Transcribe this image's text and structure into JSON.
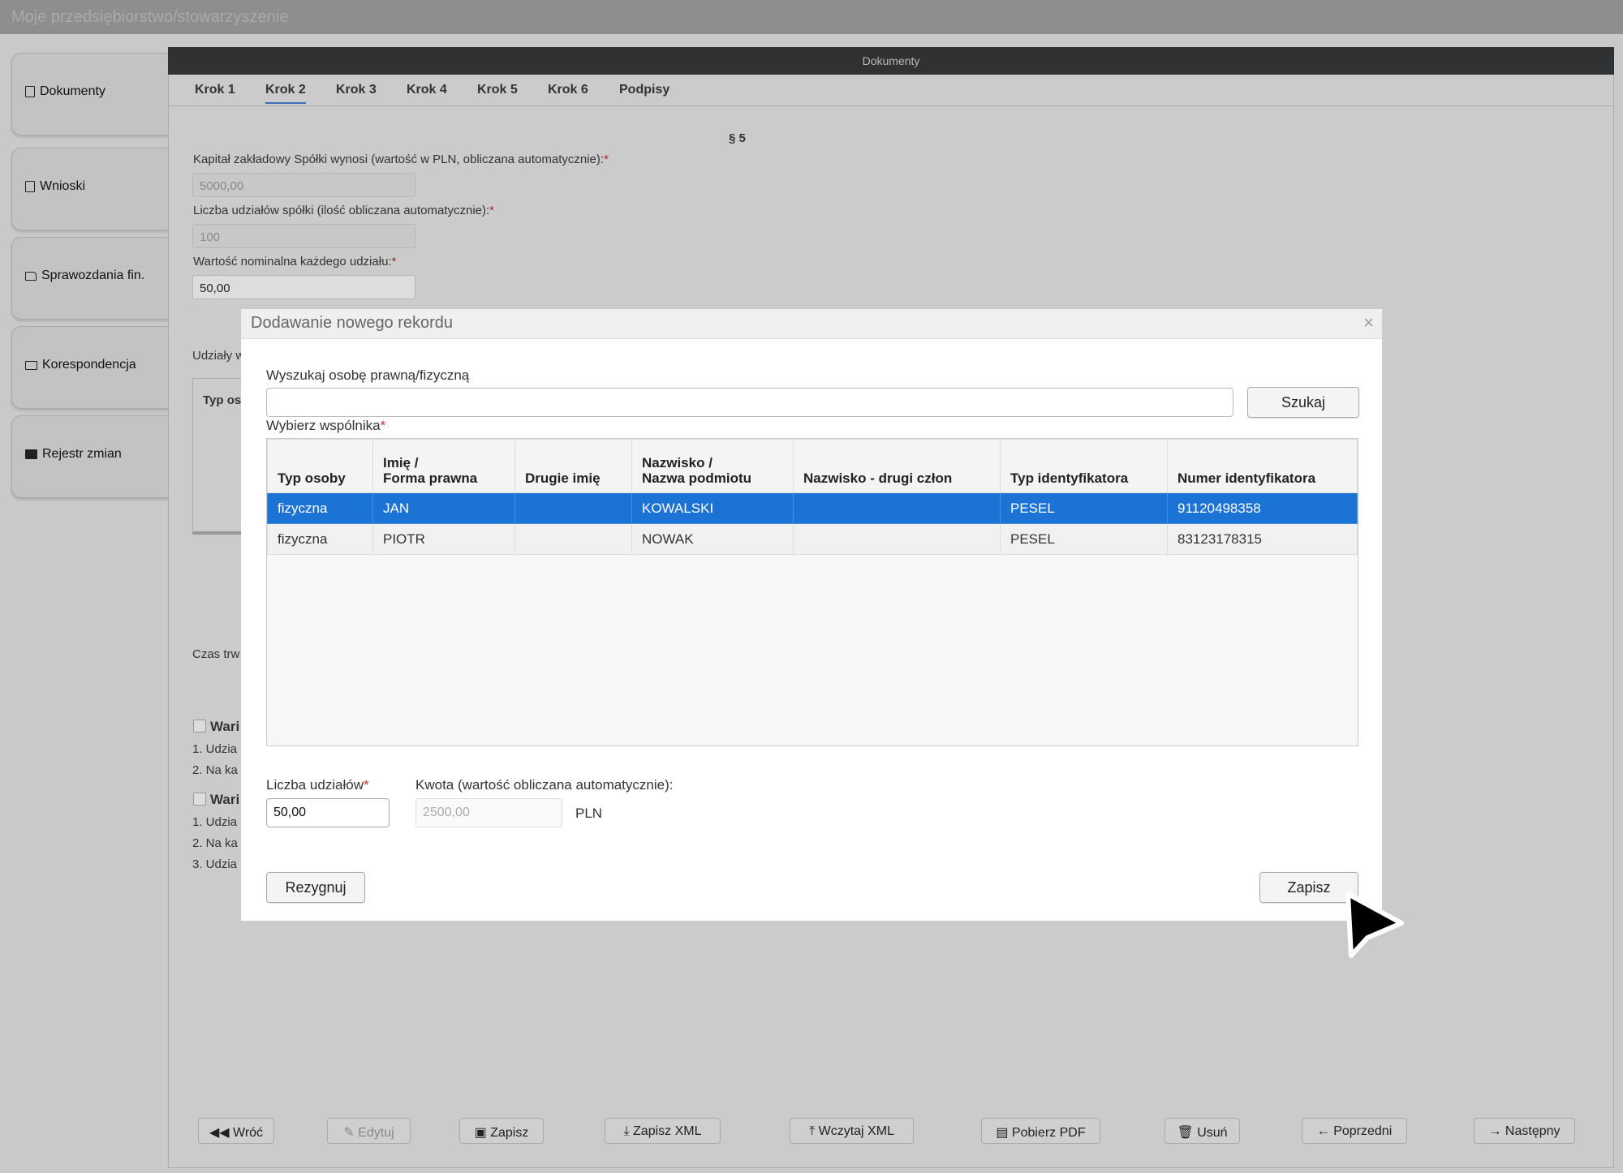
{
  "window": {
    "title": "Moje przedsiębiorstwo/stowarzyszenie"
  },
  "sidebar": {
    "items": [
      {
        "label": "Dokumenty",
        "icon": "document-icon"
      },
      {
        "label": "Wnioski",
        "icon": "document-icon"
      },
      {
        "label": "Sprawozdania fin.",
        "icon": "folder-open-icon"
      },
      {
        "label": "Korespondencja",
        "icon": "envelope-icon"
      },
      {
        "label": "Rejestr zmian",
        "icon": "briefcase-icon"
      }
    ]
  },
  "panel": {
    "title": "Dokumenty",
    "tabs": [
      "Krok 1",
      "Krok 2",
      "Krok 3",
      "Krok 4",
      "Krok 5",
      "Krok 6",
      "Podpisy"
    ],
    "active_tab": "Krok 2",
    "section": "§ 5",
    "capital_label": "Kapitał zakładowy Spółki wynosi (wartość w PLN, obliczana automatycznie):",
    "capital_value": "5000,00",
    "shares_count_label": "Liczba udziałów spółki (ilość obliczana automatycznie):",
    "shares_count_value": "100",
    "nominal_label": "Wartość nominalna każdego udziału:",
    "nominal_value": "50,00",
    "partial_shares_label": "Udziały w",
    "partial_typ": "Typ os",
    "partial_czas": "Czas trw",
    "partial_wari_1": "Wari",
    "partial_wari_2": "Wari",
    "partial_lines_1": [
      "1. Udzia",
      "2. Na ka"
    ],
    "partial_lines_2": [
      "1. Udzia",
      "2. Na ka",
      "3. Udzia"
    ]
  },
  "footer_buttons": [
    "Wróć",
    "Edytuj",
    "Zapisz",
    "Zapisz XML",
    "Wczytaj XML",
    "Pobierz PDF",
    "Usuń",
    "Poprzedni",
    "Następny"
  ],
  "modal": {
    "title": "Dodawanie nowego rekordu",
    "close": "×",
    "search_label": "Wyszukaj osobę prawną/fizyczną",
    "search_value": "",
    "search_button": "Szukaj",
    "select_label": "Wybierz wspólnika",
    "columns": [
      "Typ osoby",
      "Imię / Forma prawna",
      "Drugie imię",
      "Nazwisko / Nazwa podmiotu",
      "Nazwisko - drugi człon",
      "Typ identyfikatora",
      "Numer identyfikatora"
    ],
    "columns_lines": [
      [
        "Typ osoby"
      ],
      [
        "Imię /",
        "Forma prawna"
      ],
      [
        "Drugie imię"
      ],
      [
        "Nazwisko /",
        "Nazwa podmiotu"
      ],
      [
        "Nazwisko - drugi człon"
      ],
      [
        "Typ identyfikatora"
      ],
      [
        "Numer identyfikatora"
      ]
    ],
    "rows": [
      [
        "fizyczna",
        "JAN",
        "",
        "KOWALSKI",
        "",
        "PESEL",
        "91120498358"
      ],
      [
        "fizyczna",
        "PIOTR",
        "",
        "NOWAK",
        "",
        "PESEL",
        "83123178315"
      ]
    ],
    "selected_row": 0,
    "shares_label": "Liczba udziałów",
    "shares_value": "50,00",
    "amount_label": "Kwota (wartość obliczana automatycznie):",
    "amount_value": "2500,00",
    "currency": "PLN",
    "cancel_button": "Rezygnuj",
    "save_button": "Zapisz"
  }
}
